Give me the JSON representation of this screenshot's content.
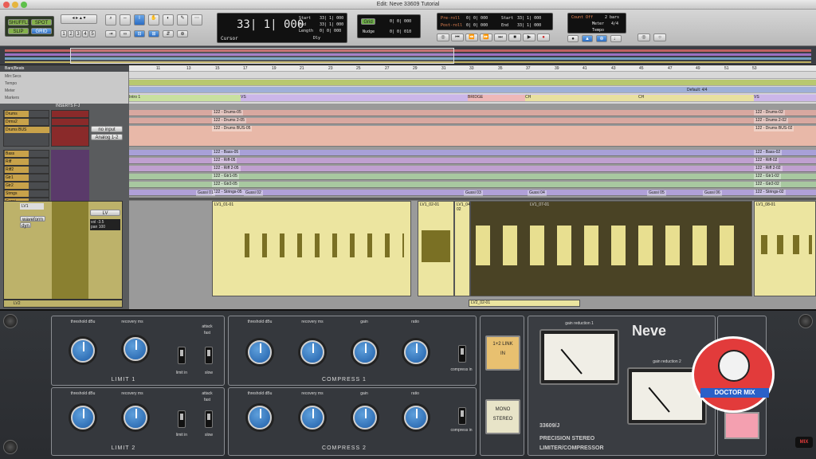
{
  "window": {
    "title": "Edit: Neve 33609 Tutorial"
  },
  "toolbar": {
    "mode_buttons": [
      "SHUFFLE",
      "SPOT",
      "SLIP",
      "GRID"
    ],
    "counter_main": "33| 1| 000",
    "counter_label": "Cursor",
    "start_label": "Start",
    "start_value": "33| 1| 000",
    "end_label": "End",
    "end_value": "33| 1| 000",
    "length_label": "Length",
    "length_value": "0| 0| 000",
    "grid_label": "Grid",
    "grid_value": "0| 0| 000",
    "nudge_label": "Nudge",
    "nudge_value": "0| 0| 010",
    "preroll_label": "Pre-roll",
    "preroll_value": "0| 0| 000",
    "postroll_label": "Post-roll",
    "postroll_value": "0| 0| 000",
    "transport_start": "33| 1| 000",
    "transport_end": "33| 1| 000",
    "countoff_label": "Count Off",
    "meter_label": "Meter",
    "tempo_label": "Tempo",
    "countoff_value": "2 bars",
    "meter_value": "4/4",
    "dly_label": "Dly"
  },
  "ruler": {
    "rows": [
      "Bars|Beats",
      "Min:Secs",
      "Tempo",
      "Meter",
      "Markers"
    ],
    "bars": [
      "11",
      "13",
      "15",
      "17",
      "19",
      "21",
      "23",
      "25",
      "27",
      "29",
      "31",
      "33",
      "35",
      "37",
      "39",
      "41",
      "43",
      "45",
      "47",
      "49",
      "51",
      "53"
    ],
    "markers": [
      {
        "label": "Intro 1"
      },
      {
        "label": "VS"
      },
      {
        "label": "BRIDGE"
      },
      {
        "label": "CH"
      },
      {
        "label": "CH"
      },
      {
        "label": "VS"
      }
    ],
    "meter_value": "Default: 4/4"
  },
  "tracks": {
    "header_label": "INSERTS F-J",
    "items": [
      {
        "name": "Drums",
        "clip": "122 - Drums-05"
      },
      {
        "name": "Drms2",
        "clip": "122 - Drums 2-05"
      },
      {
        "name": "Drums BUS",
        "clip": "122 - Drums BUS-05"
      },
      {
        "name": "Bass",
        "clip": "122 - Bass-05"
      },
      {
        "name": "Riff",
        "clip": "122 - Riff-05"
      },
      {
        "name": "Riff2",
        "clip": "122 - Riff 2-05"
      },
      {
        "name": "Gtr1",
        "clip": "122 - Gtr1-05"
      },
      {
        "name": "Gtr2",
        "clip": "122 - Gtr2-05"
      },
      {
        "name": "Strngs",
        "clip": "122 - Strings-05"
      },
      {
        "name": "Gussi",
        "clip": ""
      }
    ],
    "end_clips": [
      "122 - Drums-02",
      "122 - Drums 2-02",
      "122 - Drums BUS-02",
      "122 - Bass-02",
      "122 - Riff-02",
      "122 - Riff 2-02",
      "122 - Gtr1-02",
      "122 - Gtr2-02",
      "122 - Strings-02"
    ],
    "no_input": "no input",
    "analog_input": "Analog 1-2",
    "vocal_track": {
      "name": "LV1",
      "second": "LV2",
      "output": "LV",
      "waveform": "waveform",
      "dyn": "dyn",
      "vol": "vol",
      "pan": "pan",
      "vol_value": "-3.5",
      "pan_value": "100"
    },
    "vocal_clips": [
      "LV1_01-01",
      "LV1_02-01",
      "LV1_04-02",
      "LV1_07-01",
      "LV1_08-01"
    ],
    "lv2_clip": "LV2_02-01",
    "small_clips": [
      "Gussi 01",
      "Gussi 02",
      "Gussi 03",
      "Gussi 04",
      "Gussi 05",
      "Gussi 06"
    ]
  },
  "plugin": {
    "limit1": {
      "threshold": "threshold dBu",
      "recovery": "recovery ms",
      "attack": "attack",
      "fast": "fast",
      "slow": "slow",
      "limit_in": "limit in",
      "label": "LIMIT 1"
    },
    "limit2": {
      "threshold": "threshold dBu",
      "recovery": "recovery ms",
      "attack": "attack",
      "fast": "fast",
      "slow": "slow",
      "limit_in": "limit in",
      "label": "LIMIT 2"
    },
    "compress1": {
      "threshold": "threshold dBu",
      "recovery": "recovery ms",
      "gain": "gain",
      "ratio": "ratio",
      "compress_in": "compress in",
      "label": "COMPRESS 1"
    },
    "compress2": {
      "threshold": "threshold dBu",
      "recovery": "recovery ms",
      "gain": "gain",
      "ratio": "ratio",
      "compress_in": "compress in",
      "label": "COMPRESS 2"
    },
    "link_label": "1+2 LINK",
    "link_in": "IN",
    "mono": "MONO",
    "stereo": "STEREO",
    "gr1": "gain reduction 1",
    "gr2": "gain reduction 2",
    "brand": "Neve",
    "model": "33609/J",
    "desc1": "PRECISION STEREO",
    "desc2": "LIMITER/COMPRESSOR",
    "logo_text": "DOCTOR MIX",
    "mix_badge": "MIX",
    "colors": {
      "knob": "#2f6fb8",
      "panel": "#35383d",
      "accent": "#e23b3b"
    }
  }
}
